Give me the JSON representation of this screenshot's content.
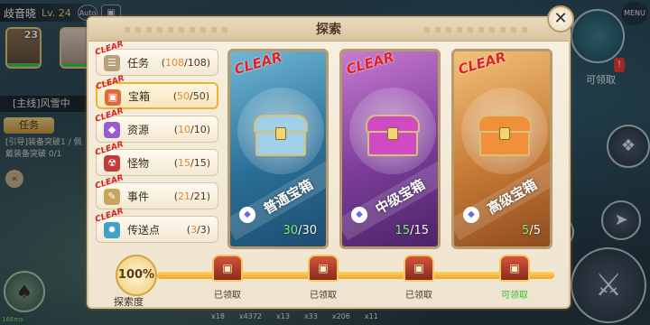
{
  "hud": {
    "player_name": "歧音晓",
    "player_level": "Lv. 24",
    "auto_label": "Auto",
    "avatar1_level": "23",
    "quest_title": "[主线]风雪中",
    "quest_tab": "任务",
    "quest_desc": "[引导]装备突破1 / 佩戴装备突破 0/1",
    "menu_label": "MENU",
    "claim_label": "可领取",
    "alert_mark": "!",
    "ping": "166ms",
    "bottom_items": [
      "x18",
      "x4372",
      "x13",
      "x33",
      "x206",
      "x11"
    ]
  },
  "dialog": {
    "title": "探索",
    "close_symbol": "✕"
  },
  "categories": [
    {
      "label": "任务",
      "got": "108",
      "total": "108",
      "icon": "quest-icon",
      "icon_color": "#b8a07a",
      "clear": "CLEAR",
      "active": false
    },
    {
      "label": "宝箱",
      "got": "50",
      "total": "50",
      "icon": "chest-icon",
      "icon_color": "#e0693a",
      "clear": "CLEAR",
      "active": true
    },
    {
      "label": "资源",
      "got": "10",
      "total": "10",
      "icon": "resource-icon",
      "icon_color": "#9a5bd0",
      "clear": "CLEAR",
      "active": false
    },
    {
      "label": "怪物",
      "got": "15",
      "total": "15",
      "icon": "monster-icon",
      "icon_color": "#c43a3a",
      "clear": "CLEAR",
      "active": false
    },
    {
      "label": "事件",
      "got": "21",
      "total": "21",
      "icon": "event-icon",
      "icon_color": "#c9a45a",
      "clear": "CLEAR",
      "active": false
    },
    {
      "label": "传送点",
      "got": "3",
      "total": "3",
      "icon": "teleport-icon",
      "icon_color": "#3fa0c8",
      "clear": "CLEAR",
      "active": false
    }
  ],
  "cards": [
    {
      "name": "普通宝箱",
      "got": "30",
      "total": "30",
      "clear": "CLEAR",
      "theme": "blue"
    },
    {
      "name": "中级宝箱",
      "got": "15",
      "total": "15",
      "clear": "CLEAR",
      "theme": "purple"
    },
    {
      "name": "高级宝箱",
      "got": "5",
      "total": "5",
      "clear": "CLEAR",
      "theme": "gold"
    }
  ],
  "progress": {
    "percent_text": "100%",
    "percent_value": 1.0,
    "label": "探索度",
    "milestones": [
      {
        "label": "已领取",
        "state": "claimed"
      },
      {
        "label": "已领取",
        "state": "claimed"
      },
      {
        "label": "已领取",
        "state": "claimed"
      },
      {
        "label": "可领取",
        "state": "claimable"
      }
    ]
  },
  "colors": {
    "accent_gold": "#f0b233",
    "clear_red": "#d82020",
    "claimable_green": "#2fbf35",
    "count_orange": "#e9862a"
  }
}
